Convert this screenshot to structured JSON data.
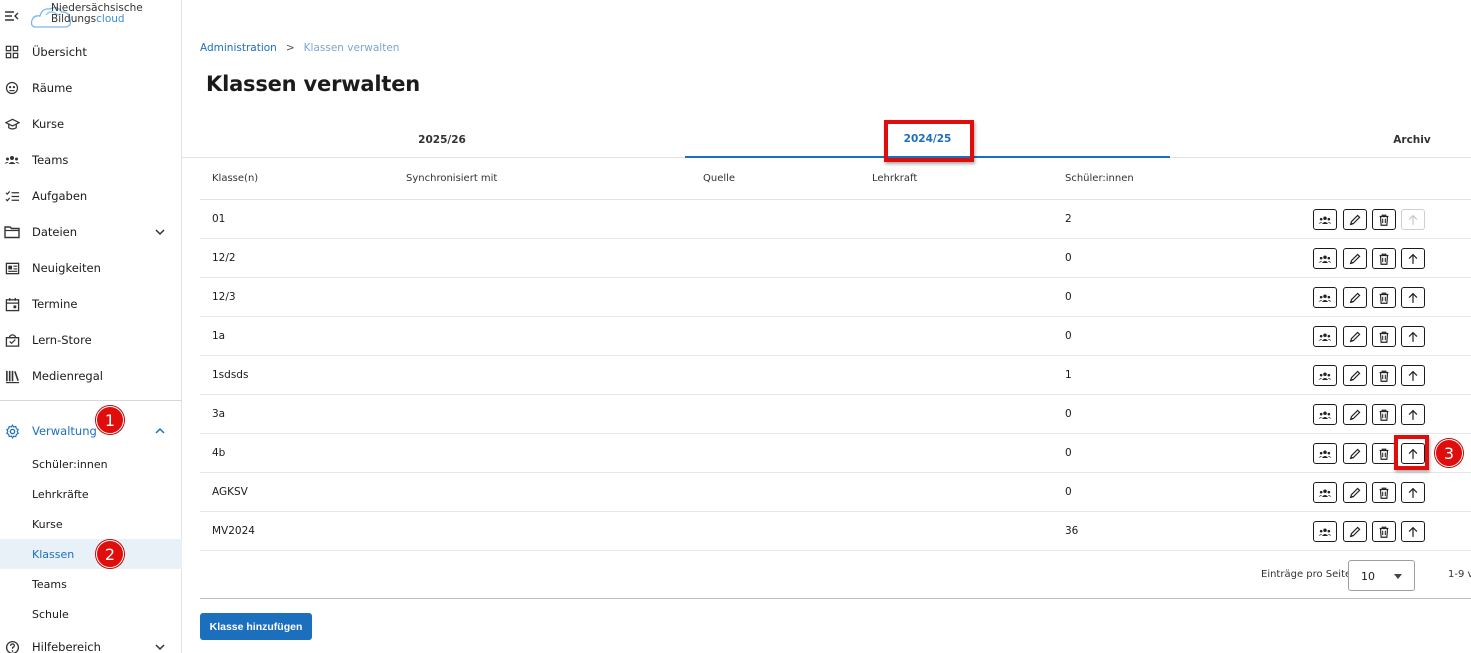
{
  "logo": {
    "line1": "Niedersächsische",
    "line2a": "Bildungs",
    "line2b": "cloud"
  },
  "sidebar": {
    "items": [
      {
        "label": "Übersicht",
        "icon": "dashboard-icon"
      },
      {
        "label": "Räume",
        "icon": "rooms-icon"
      },
      {
        "label": "Kurse",
        "icon": "courses-icon"
      },
      {
        "label": "Teams",
        "icon": "teams-icon"
      },
      {
        "label": "Aufgaben",
        "icon": "tasks-icon"
      },
      {
        "label": "Dateien",
        "icon": "folder-icon"
      },
      {
        "label": "Neuigkeiten",
        "icon": "news-icon"
      },
      {
        "label": "Termine",
        "icon": "calendar-icon"
      },
      {
        "label": "Lern-Store",
        "icon": "store-icon"
      },
      {
        "label": "Medienregal",
        "icon": "media-shelf-icon"
      }
    ],
    "admin": {
      "label": "Verwaltung",
      "icon": "gear-icon"
    },
    "admin_sub": [
      "Schüler:innen",
      "Lehrkräfte",
      "Kurse",
      "Klassen",
      "Teams",
      "Schule"
    ],
    "help": {
      "label": "Hilfebereich",
      "icon": "help-icon"
    }
  },
  "markers": [
    "1",
    "2",
    "3"
  ],
  "breadcrumb": {
    "parent": "Administration",
    "sep": ">",
    "current": "Klassen verwalten"
  },
  "page_title": "Klassen verwalten",
  "tabs": [
    "2025/26",
    "2024/25",
    "Archiv"
  ],
  "table": {
    "headers": [
      "Klasse(n)",
      "Synchronisiert mit",
      "Quelle",
      "Lehrkraft",
      "Schüler:innen"
    ],
    "rows": [
      {
        "name": "01",
        "students": "2"
      },
      {
        "name": "12/2",
        "students": "0"
      },
      {
        "name": "12/3",
        "students": "0"
      },
      {
        "name": "1a",
        "students": "0"
      },
      {
        "name": "1sdsds",
        "students": "1"
      },
      {
        "name": "3a",
        "students": "0"
      },
      {
        "name": "4b",
        "students": "0"
      },
      {
        "name": "AGKSV",
        "students": "0"
      },
      {
        "name": "MV2024",
        "students": "36"
      }
    ]
  },
  "footer": {
    "per_page_label": "Einträge pro Seite",
    "per_page_value": "10",
    "range": "1-9 v"
  },
  "add_button": "Klasse hinzufügen",
  "colors": {
    "accent": "#1b6fbd",
    "marker": "#e00d0d"
  }
}
